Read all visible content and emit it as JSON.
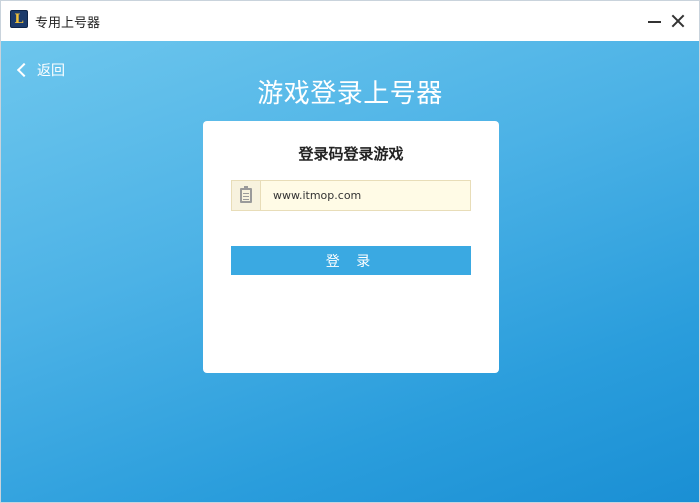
{
  "window": {
    "title": "专用上号器",
    "icon": "app-logo-L",
    "icon_letter": "L"
  },
  "nav": {
    "back_label": "返回"
  },
  "main": {
    "title": "游戏登录上号器"
  },
  "login_card": {
    "title": "登录码登录游戏",
    "code_input_value": "www.itmop.com",
    "code_input_icon": "clipboard-icon",
    "login_button_label": "登 录"
  },
  "colors": {
    "accent": "#3aa9e2",
    "background_top": "#6dc6ed",
    "background_bottom": "#1a8fd4",
    "input_background": "#fffbe6"
  }
}
